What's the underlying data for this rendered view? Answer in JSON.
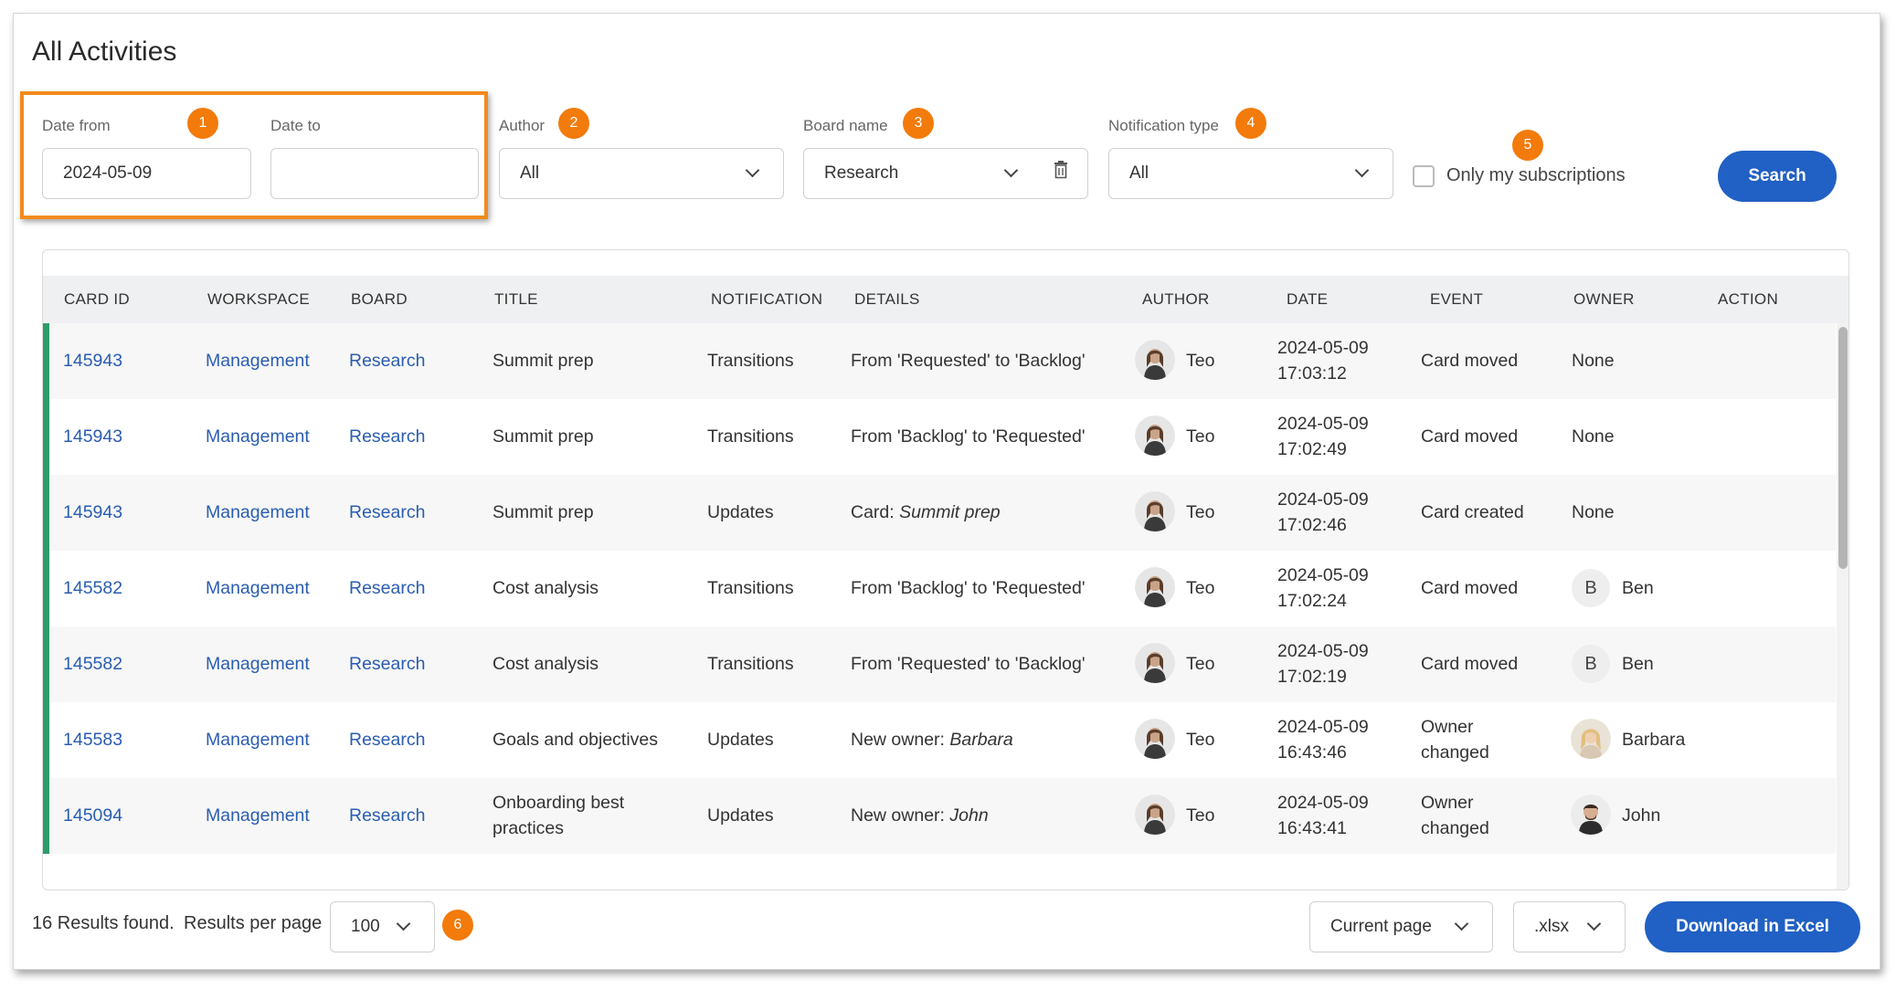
{
  "page": {
    "title": "All Activities"
  },
  "filters": {
    "date_from": {
      "label": "Date from",
      "value": "2024-05-09",
      "badge": "1"
    },
    "date_to": {
      "label": "Date to",
      "value": ""
    },
    "author": {
      "label": "Author",
      "value": "All",
      "badge": "2"
    },
    "board_name": {
      "label": "Board name",
      "value": "Research",
      "badge": "3"
    },
    "notification_type": {
      "label": "Notification type",
      "value": "All",
      "badge": "4"
    },
    "only_subscriptions": {
      "label": "Only my subscriptions",
      "checked": false,
      "badge": "5"
    },
    "search_button": "Search"
  },
  "table": {
    "columns": [
      "CARD ID",
      "WORKSPACE",
      "BOARD",
      "TITLE",
      "NOTIFICATION",
      "DETAILS",
      "AUTHOR",
      "DATE",
      "EVENT",
      "OWNER",
      "ACTION"
    ],
    "rows": [
      {
        "card_id": "145943",
        "workspace": "Management",
        "board": "Research",
        "title": [
          "Summit prep"
        ],
        "notification": "Transitions",
        "details_prefix": "From 'Requested' to 'Backlog'",
        "details_em": "",
        "author": "Teo",
        "date": "2024-05-09",
        "time": "17:03:12",
        "event": [
          "Card moved"
        ],
        "owner": "None",
        "owner_avatar": "none"
      },
      {
        "card_id": "145943",
        "workspace": "Management",
        "board": "Research",
        "title": [
          "Summit prep"
        ],
        "notification": "Transitions",
        "details_prefix": "From 'Backlog' to 'Requested'",
        "details_em": "",
        "author": "Teo",
        "date": "2024-05-09",
        "time": "17:02:49",
        "event": [
          "Card moved"
        ],
        "owner": "None",
        "owner_avatar": "none"
      },
      {
        "card_id": "145943",
        "workspace": "Management",
        "board": "Research",
        "title": [
          "Summit prep"
        ],
        "notification": "Updates",
        "details_prefix": "Card: ",
        "details_em": "Summit prep",
        "author": "Teo",
        "date": "2024-05-09",
        "time": "17:02:46",
        "event": [
          "Card created"
        ],
        "owner": "None",
        "owner_avatar": "none"
      },
      {
        "card_id": "145582",
        "workspace": "Management",
        "board": "Research",
        "title": [
          "Cost analysis"
        ],
        "notification": "Transitions",
        "details_prefix": "From 'Backlog' to 'Requested'",
        "details_em": "",
        "author": "Teo",
        "date": "2024-05-09",
        "time": "17:02:24",
        "event": [
          "Card moved"
        ],
        "owner": "Ben",
        "owner_avatar": "letter",
        "owner_initial": "B"
      },
      {
        "card_id": "145582",
        "workspace": "Management",
        "board": "Research",
        "title": [
          "Cost analysis"
        ],
        "notification": "Transitions",
        "details_prefix": "From 'Requested' to 'Backlog'",
        "details_em": "",
        "author": "Teo",
        "date": "2024-05-09",
        "time": "17:02:19",
        "event": [
          "Card moved"
        ],
        "owner": "Ben",
        "owner_avatar": "letter",
        "owner_initial": "B"
      },
      {
        "card_id": "145583",
        "workspace": "Management",
        "board": "Research",
        "title": [
          "Goals and objectives"
        ],
        "notification": "Updates",
        "details_prefix": "New owner: ",
        "details_em": "Barbara",
        "author": "Teo",
        "date": "2024-05-09",
        "time": "16:43:46",
        "event": [
          "Owner",
          "changed"
        ],
        "owner": "Barbara",
        "owner_avatar": "female"
      },
      {
        "card_id": "145094",
        "workspace": "Management",
        "board": "Research",
        "title": [
          "Onboarding best",
          "practices"
        ],
        "notification": "Updates",
        "details_prefix": "New owner: ",
        "details_em": "John",
        "author": "Teo",
        "date": "2024-05-09",
        "time": "16:43:41",
        "event": [
          "Owner",
          "changed"
        ],
        "owner": "John",
        "owner_avatar": "male"
      }
    ]
  },
  "footer": {
    "results_text": "16 Results found.",
    "per_page_label": "Results per page",
    "per_page_value": "100",
    "badge": "6",
    "export_scope": "Current page",
    "export_format": ".xlsx",
    "download_button": "Download in Excel"
  },
  "colors": {
    "accent_blue": "#2160c4",
    "badge_orange": "#f27b0b",
    "link_blue": "#2a5db0",
    "row_accent_green": "#2e9b6b"
  }
}
